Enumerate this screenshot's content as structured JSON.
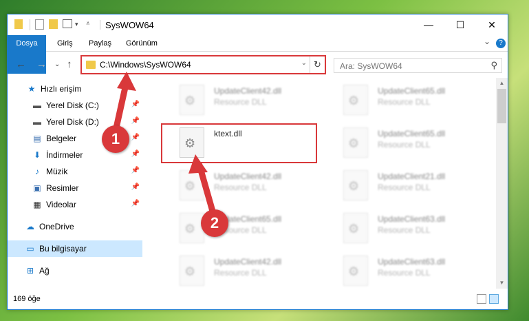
{
  "window": {
    "title": "SysWOW64",
    "buttons": {
      "minimize": "—",
      "maximize": "☐",
      "close": "✕"
    }
  },
  "ribbon": {
    "tabs": [
      "Dosya",
      "Giriş",
      "Paylaş",
      "Görünüm"
    ],
    "expand": "⌄",
    "help": "?"
  },
  "nav": {
    "back": "←",
    "forward": "→",
    "recent": "⌄",
    "up": "↑",
    "address": "C:\\Windows\\SysWOW64",
    "refresh": "↻",
    "search_placeholder": "Ara: SysWOW64"
  },
  "sidebar": {
    "items": [
      {
        "label": "Hızlı erişim",
        "icon": "star-icon",
        "glyph": "★",
        "color": "#1979ca",
        "pinned": false
      },
      {
        "label": "Yerel Disk (C:)",
        "icon": "drive-icon",
        "glyph": "▬",
        "color": "#555",
        "pinned": true
      },
      {
        "label": "Yerel Disk (D:)",
        "icon": "drive-icon",
        "glyph": "▬",
        "color": "#555",
        "pinned": true
      },
      {
        "label": "Belgeler",
        "icon": "documents-icon",
        "glyph": "▤",
        "color": "#3a6fb0",
        "pinned": true
      },
      {
        "label": "İndirmeler",
        "icon": "downloads-icon",
        "glyph": "⬇",
        "color": "#1979ca",
        "pinned": true
      },
      {
        "label": "Müzik",
        "icon": "music-icon",
        "glyph": "♪",
        "color": "#1979ca",
        "pinned": true
      },
      {
        "label": "Resimler",
        "icon": "pictures-icon",
        "glyph": "▣",
        "color": "#3a6fb0",
        "pinned": true
      },
      {
        "label": "Videolar",
        "icon": "videos-icon",
        "glyph": "▦",
        "color": "#333",
        "pinned": true
      },
      {
        "label": "OneDrive",
        "icon": "onedrive-icon",
        "glyph": "☁",
        "color": "#1979ca",
        "pinned": false
      },
      {
        "label": "Bu bilgisayar",
        "icon": "computer-icon",
        "glyph": "▭",
        "color": "#1979ca",
        "pinned": false,
        "selected": true
      },
      {
        "label": "Ağ",
        "icon": "network-icon",
        "glyph": "⊞",
        "color": "#1979ca",
        "pinned": false
      }
    ]
  },
  "files": [
    {
      "name": "UpdateClient42.dll",
      "type": "Resource DLL",
      "blurred": true
    },
    {
      "name": "UpdateClient65.dll",
      "type": "Resource DLL",
      "blurred": true
    },
    {
      "name": "ktext.dll",
      "type": "",
      "blurred": false
    },
    {
      "name": "UpdateClient65.dll",
      "type": "Resource DLL",
      "blurred": true
    },
    {
      "name": "UpdateClient42.dll",
      "type": "Resource DLL",
      "blurred": true
    },
    {
      "name": "UpdateClient21.dll",
      "type": "Resource DLL",
      "blurred": true
    },
    {
      "name": "UpdateClient65.dll",
      "type": "Resource DLL",
      "blurred": true
    },
    {
      "name": "UpdateClient63.dll",
      "type": "Resource DLL",
      "blurred": true
    },
    {
      "name": "UpdateClient42.dll",
      "type": "Resource DLL",
      "blurred": true
    },
    {
      "name": "UpdateClient63.dll",
      "type": "Resource DLL",
      "blurred": true
    }
  ],
  "status": {
    "count": "169 öğe"
  },
  "annotations": {
    "step1": "1",
    "step2": "2",
    "color": "#d9383a"
  }
}
